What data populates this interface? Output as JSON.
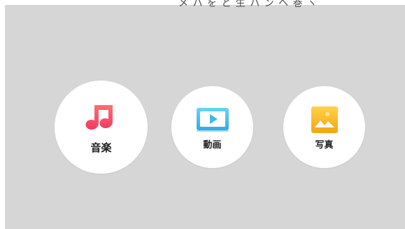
{
  "header": {
    "partial_text": "メ ハ を と 生 ハ ン   ヘ 巻 ヽ"
  },
  "menu": {
    "items": [
      {
        "label": "音楽",
        "icon": "music-note-icon",
        "accent": "#f04b67"
      },
      {
        "label": "動画",
        "icon": "video-player-icon",
        "accent": "#42b7e8"
      },
      {
        "label": "写真",
        "icon": "photo-image-icon",
        "accent": "#f5b622"
      }
    ]
  },
  "colors": {
    "background": "#d6d6d6",
    "card": "#ffffff",
    "text": "#222222"
  }
}
